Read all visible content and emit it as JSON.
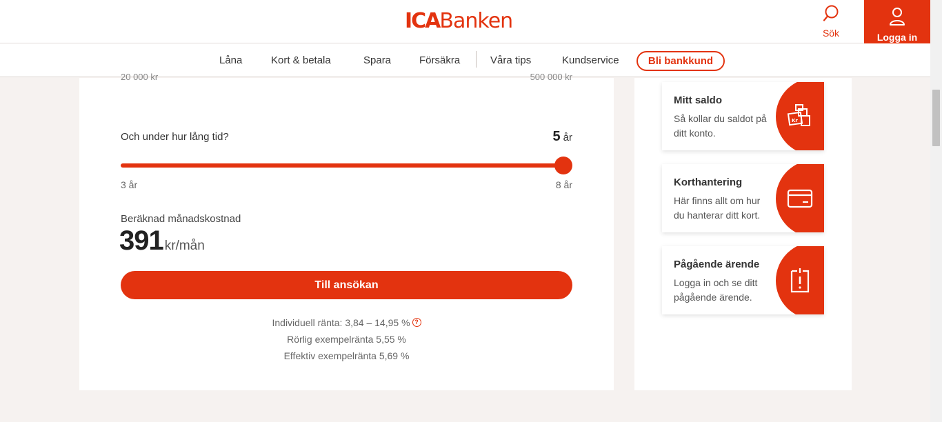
{
  "brand": {
    "ica": "ICA",
    "bank": "Banken",
    "accent": "#e3330f"
  },
  "header": {
    "search_label": "Sök",
    "login_label": "Logga in"
  },
  "nav": {
    "items": [
      "Låna",
      "Kort & betala",
      "Spara",
      "Försäkra",
      "Våra tips",
      "Kundservice"
    ],
    "cta": "Bli bankkund"
  },
  "calculator": {
    "amount_min_label": "20 000 kr",
    "amount_max_label": "500 000 kr",
    "duration_question": "Och under hur lång tid?",
    "duration_value": "5",
    "duration_unit": "år",
    "duration_min_label": "3 år",
    "duration_max_label": "8 år",
    "slider_fraction": 1.0,
    "cost_label": "Beräknad månadskostnad",
    "cost_value": "391",
    "cost_unit": "kr/mån",
    "apply_button": "Till ansökan",
    "rate_individual": "Individuell ränta: 3,84 – 14,95 %",
    "rate_variable": "Rörlig exempelränta 5,55 %",
    "rate_effective": "Effektiv exempelränta 5,69 %"
  },
  "side": {
    "tiles": [
      {
        "title": "Mitt saldo",
        "desc": "Så kollar du saldot på ditt konto.",
        "icon": "money-stack-icon"
      },
      {
        "title": "Korthantering",
        "desc": "Här finns allt om hur du hanterar ditt kort.",
        "icon": "card-icon"
      },
      {
        "title": "Pågående ärende",
        "desc": "Logga in och se ditt pågående ärende.",
        "icon": "clipboard-alert-icon"
      }
    ]
  }
}
